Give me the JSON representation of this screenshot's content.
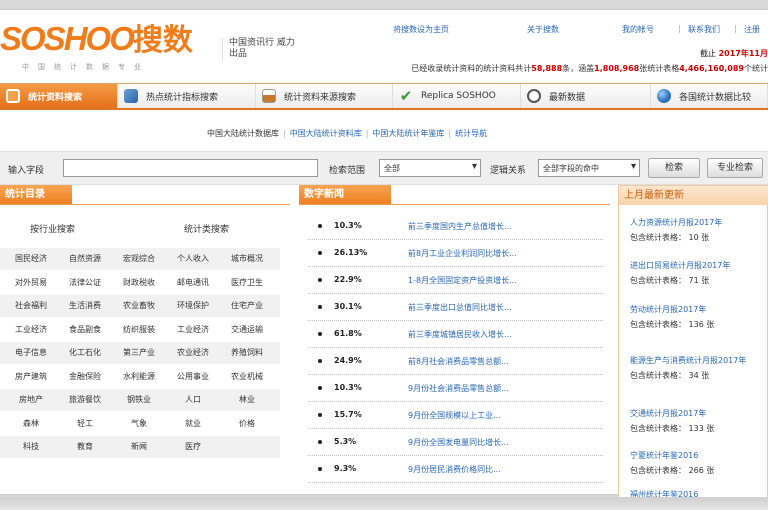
{
  "header": {
    "logo_text": "SOSHOO",
    "logo_cn": "搜数",
    "logo_sub": "中国统计数据专业",
    "slogan": "中国资讯行 威力出品",
    "top_links": [
      "将搜数设为主页",
      "关于搜数",
      "我的帐号",
      "联系我们",
      "注册"
    ],
    "announcement_prefix": "截止 ",
    "announcement_value": "2017年11月",
    "announcement2": "已经收录统计资料的统计资料共计",
    "announcement2_a": "58,888",
    "announcement2_mid": "条，涵盖",
    "announcement2_b": "1,808,968",
    "announcement2_mid2": "张统计表格",
    "announcement2_c": "4,466,160,089",
    "announcement2_end": "个统计"
  },
  "nav": {
    "items": [
      {
        "label": "统计资料搜索",
        "icon": "home-icon",
        "active": true
      },
      {
        "label": "热点统计指标搜索",
        "icon": "book-icon",
        "active": false
      },
      {
        "label": "统计资料来源搜索",
        "icon": "chart-icon",
        "active": false
      },
      {
        "label": "Replica SOSHOO",
        "icon": "check-icon",
        "active": false
      },
      {
        "label": "最新数据",
        "icon": "clock-icon",
        "active": false
      },
      {
        "label": "各国统计数据比较",
        "icon": "globe-icon",
        "active": false
      }
    ]
  },
  "breadcrumb": [
    "中国大陆统计数据库",
    "中国大陆统计资料库",
    "中国大陆统计年鉴库",
    "统计导航"
  ],
  "search": {
    "keyword_label": "输入字段",
    "keyword_value": "",
    "range_label": "检索范围",
    "range_value": "全部",
    "logic_label": "逻辑关系",
    "logic_value": "全部字段的命中",
    "search_button": "检索",
    "advanced_button": "专业检索"
  },
  "left_panel": {
    "title": "统计目录",
    "col1_title": "按行业搜索",
    "col2_title": "统计类搜索",
    "rows": [
      [
        "国民经济",
        "自然资源",
        "宏观综合",
        "个人收入",
        "城市概况"
      ],
      [
        "对外贸易",
        "法律公证",
        "财政税收",
        "邮电通讯",
        "医疗卫生"
      ],
      [
        "社会福利",
        "生活消费",
        "农业畜牧",
        "环境保护",
        "住宅产业"
      ],
      [
        "工业经济",
        "食品副食",
        "纺织服装",
        "工业经济",
        "交通运输"
      ],
      [
        "电子信息",
        "化工石化",
        "第三产业",
        "农业经济",
        "养殖饲料"
      ],
      [
        "房产建筑",
        "金融保险",
        "水利能源",
        "公用事业",
        "农业机械"
      ],
      [
        "房地产",
        "旅游餐饮",
        "钢铁业",
        "人口",
        "林业"
      ],
      [
        "森林",
        "轻工",
        "气象",
        "就业",
        "价格"
      ],
      [
        "科技",
        "教育",
        "新闻",
        "医疗"
      ]
    ]
  },
  "middle_panel": {
    "title": "数字新闻",
    "items": [
      {
        "pct": "10.3%",
        "text": "前三季度国内生产总值增长..."
      },
      {
        "pct": "26.13%",
        "text": "前8月工业企业利润同比增长..."
      },
      {
        "pct": "22.9%",
        "text": "1-8月全国固定资产投资增长..."
      },
      {
        "pct": "30.1%",
        "text": "前三季度出口总值同比增长..."
      },
      {
        "pct": "61.8%",
        "text": "前三季度城镇居民收入增长..."
      },
      {
        "pct": "24.9%",
        "text": "前8月社会消费品零售总额..."
      },
      {
        "pct": "10.3%",
        "text": "9月份社会消费品零售总额..."
      },
      {
        "pct": "15.7%",
        "text": "9月份全国规模以上工业..."
      },
      {
        "pct": "5.3%",
        "text": "9月份全国发电量同比增长..."
      },
      {
        "pct": "9.3%",
        "text": "9月份居民消费价格同比..."
      }
    ]
  },
  "right_panel": {
    "title": "上月最新更新",
    "items": [
      {
        "title": "人力资源统计月报2017年",
        "count": "包含统计表格： 10 张"
      },
      {
        "title": "进出口贸易统计月报2017年",
        "count": "包含统计表格： 71 张"
      },
      {
        "title": "劳动统计月报2017年",
        "count": "包含统计表格： 136 张"
      },
      {
        "title": "能源生产与消费统计月报2017年",
        "count": "包含统计表格： 34 张"
      },
      {
        "title": "交通统计月报2017年",
        "count": "包含统计表格： 133 张"
      },
      {
        "title": "宁夏统计年鉴2016",
        "count": "包含统计表格： 266 张"
      },
      {
        "title": "福州统计年鉴2016",
        "count": ""
      }
    ]
  }
}
